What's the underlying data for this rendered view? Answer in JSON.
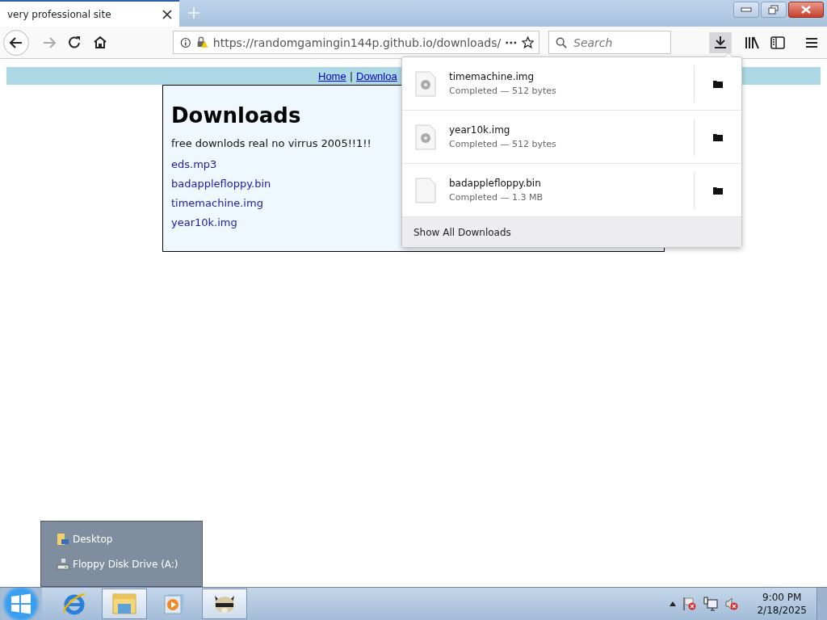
{
  "tab": {
    "title": "very professional site",
    "selected": true
  },
  "address_bar": {
    "url": "https://randomgamingin144p.github.io/downloads/"
  },
  "search": {
    "placeholder": "Search"
  },
  "downloads_button": {
    "selected": true
  },
  "page": {
    "nav": [
      "Home",
      "Downloa"
    ],
    "separator": "|",
    "heading": "Downloads",
    "text": "free downlods real no virrus 2005!!1!!",
    "links": [
      "eds.mp3",
      "badapplefloppy.bin",
      "timemachine.img",
      "year10k.img"
    ]
  },
  "downloads_panel": {
    "items": [
      {
        "name": "timemachine.img",
        "status": "Completed — 512 bytes",
        "kind": "disk"
      },
      {
        "name": "year10k.img",
        "status": "Completed — 512 bytes",
        "kind": "disk"
      },
      {
        "name": "badapplefloppy.bin",
        "status": "Completed — 1.3 MB",
        "kind": "file"
      }
    ],
    "footer": "Show All Downloads"
  },
  "jump_list": {
    "items": [
      {
        "label": "Desktop",
        "kind": "desktop"
      },
      {
        "label": "Floppy Disk Drive (A:)",
        "kind": "drive"
      }
    ]
  },
  "taskbar": {
    "apps": [
      {
        "kind": "ie",
        "running": false
      },
      {
        "kind": "explorer",
        "running": true
      },
      {
        "kind": "media",
        "running": false
      },
      {
        "kind": "raccoon",
        "running": true
      }
    ],
    "clock": {
      "time": "9:00 PM",
      "date": "2/18/2025"
    }
  }
}
